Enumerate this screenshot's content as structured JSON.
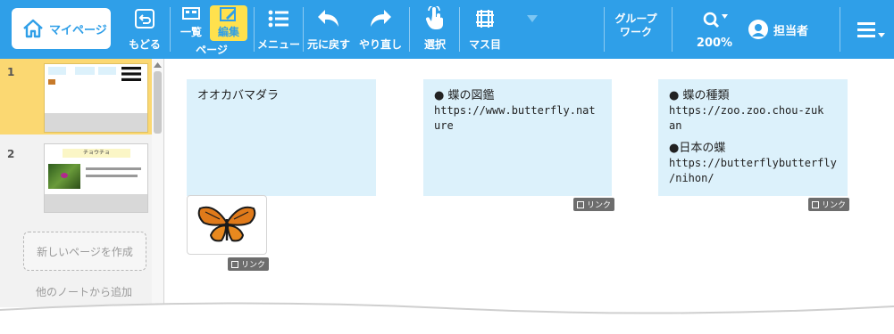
{
  "toolbar": {
    "mypage_label": "マイページ",
    "back_label": "もどる",
    "list_label": "一覧",
    "edit_label": "編集",
    "page_group_label": "ページ",
    "menu_label": "メニュー",
    "undo_label": "元に戻す",
    "redo_label": "やり直し",
    "select_label": "選択",
    "grid_label": "マス目",
    "group_work_line1": "グループ",
    "group_work_line2": "ワーク",
    "zoom_level": "200%",
    "user_label": "担当者",
    "accent_color": "#2f9fe8"
  },
  "sidebar": {
    "pages": [
      {
        "number": "1"
      },
      {
        "number": "2",
        "thumb_title": "チョウチョ"
      }
    ],
    "new_page_label": "新しいページを作成",
    "add_from_note_label": "他のノートから追加"
  },
  "canvas": {
    "cards": [
      {
        "lines": [
          "オオカバマダラ"
        ]
      },
      {
        "lines": [
          "● 蝶の図鑑",
          "https://www.butterfly.nat",
          "ure"
        ],
        "link_label": "リンク"
      },
      {
        "lines": [
          "● 蝶の種類",
          "https://zoo.zoo.chou-zuk",
          "an",
          "",
          "●日本の蝶",
          "https://butterflybutterfly",
          "/nihon/"
        ],
        "link_label": "リンク"
      }
    ],
    "image_card": {
      "alt": "butterfly",
      "link_label": "リンク"
    }
  }
}
